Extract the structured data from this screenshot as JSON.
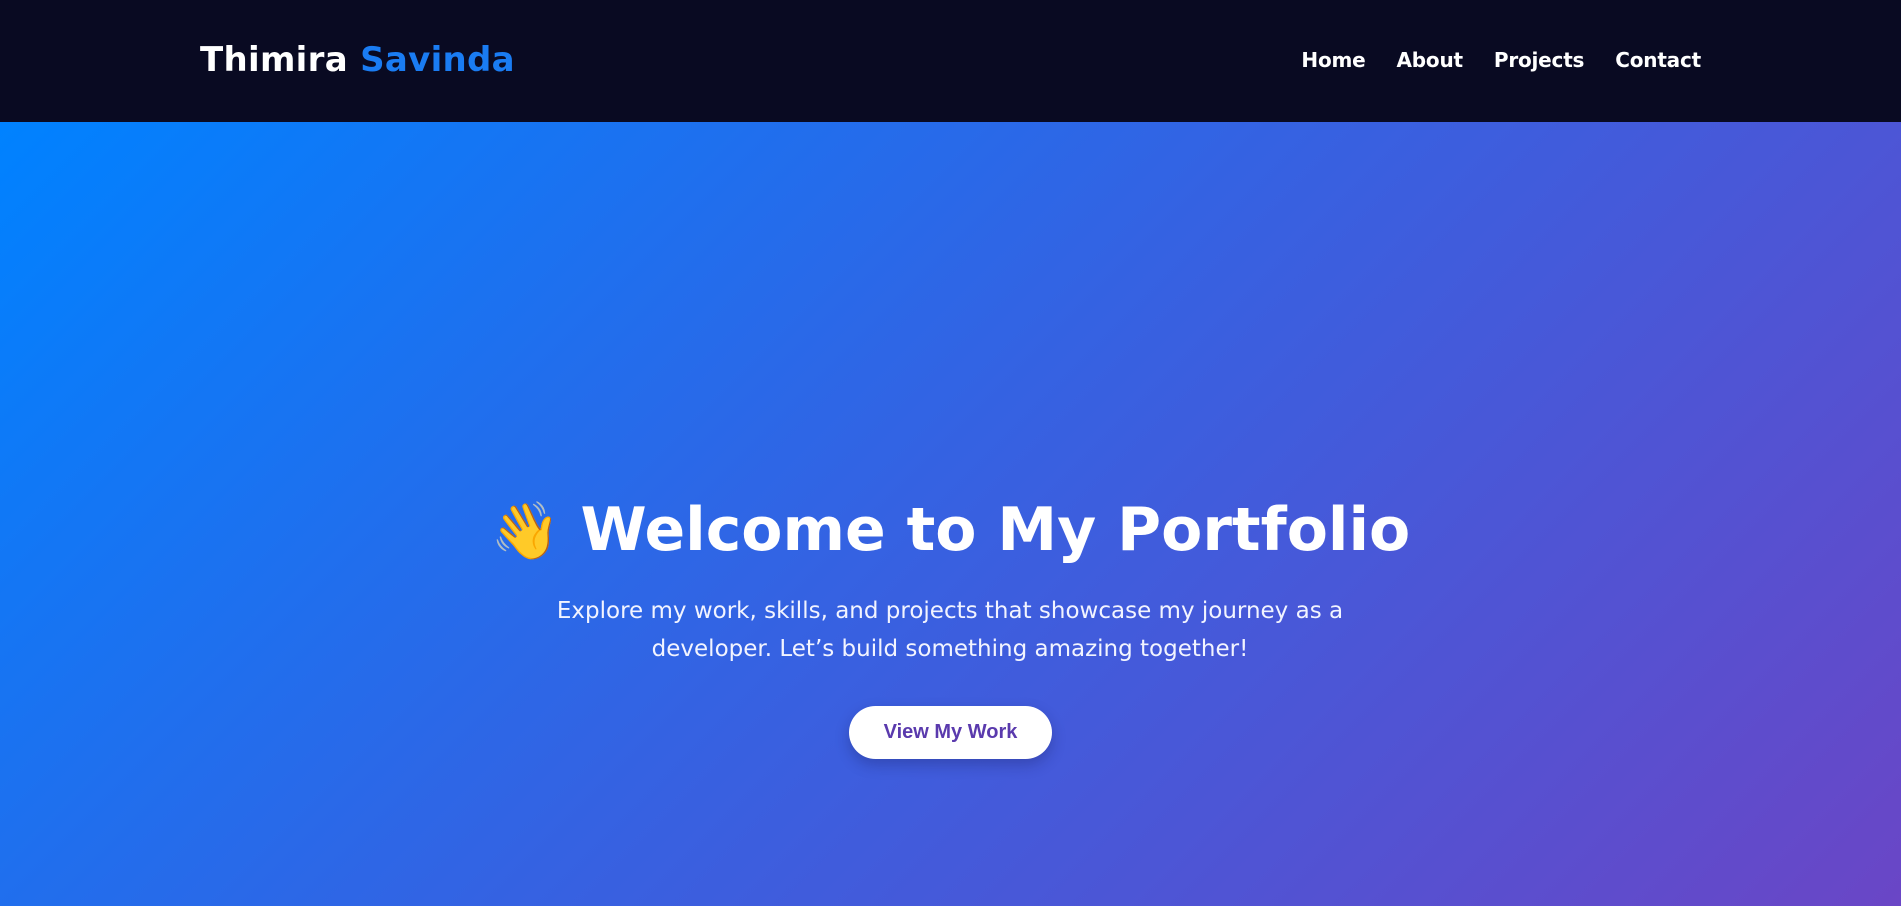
{
  "navbar": {
    "brand_first": "Thimira",
    "brand_second": "Savinda",
    "links": [
      "Home",
      "About",
      "Projects",
      "Contact"
    ]
  },
  "hero": {
    "wave_icon": "👋",
    "title": "Welcome to My Portfolio",
    "subtitle": "Explore my work, skills, and projects that showcase my journey as a developer. Let’s build something amazing together!",
    "cta_label": "View My Work"
  },
  "colors": {
    "navbar_bg": "#090a22",
    "brand_accent": "#1a7cf2",
    "hero_gradient_start": "#0082ff",
    "hero_gradient_end": "#6a46c6",
    "cta_text": "#5a3aad"
  }
}
